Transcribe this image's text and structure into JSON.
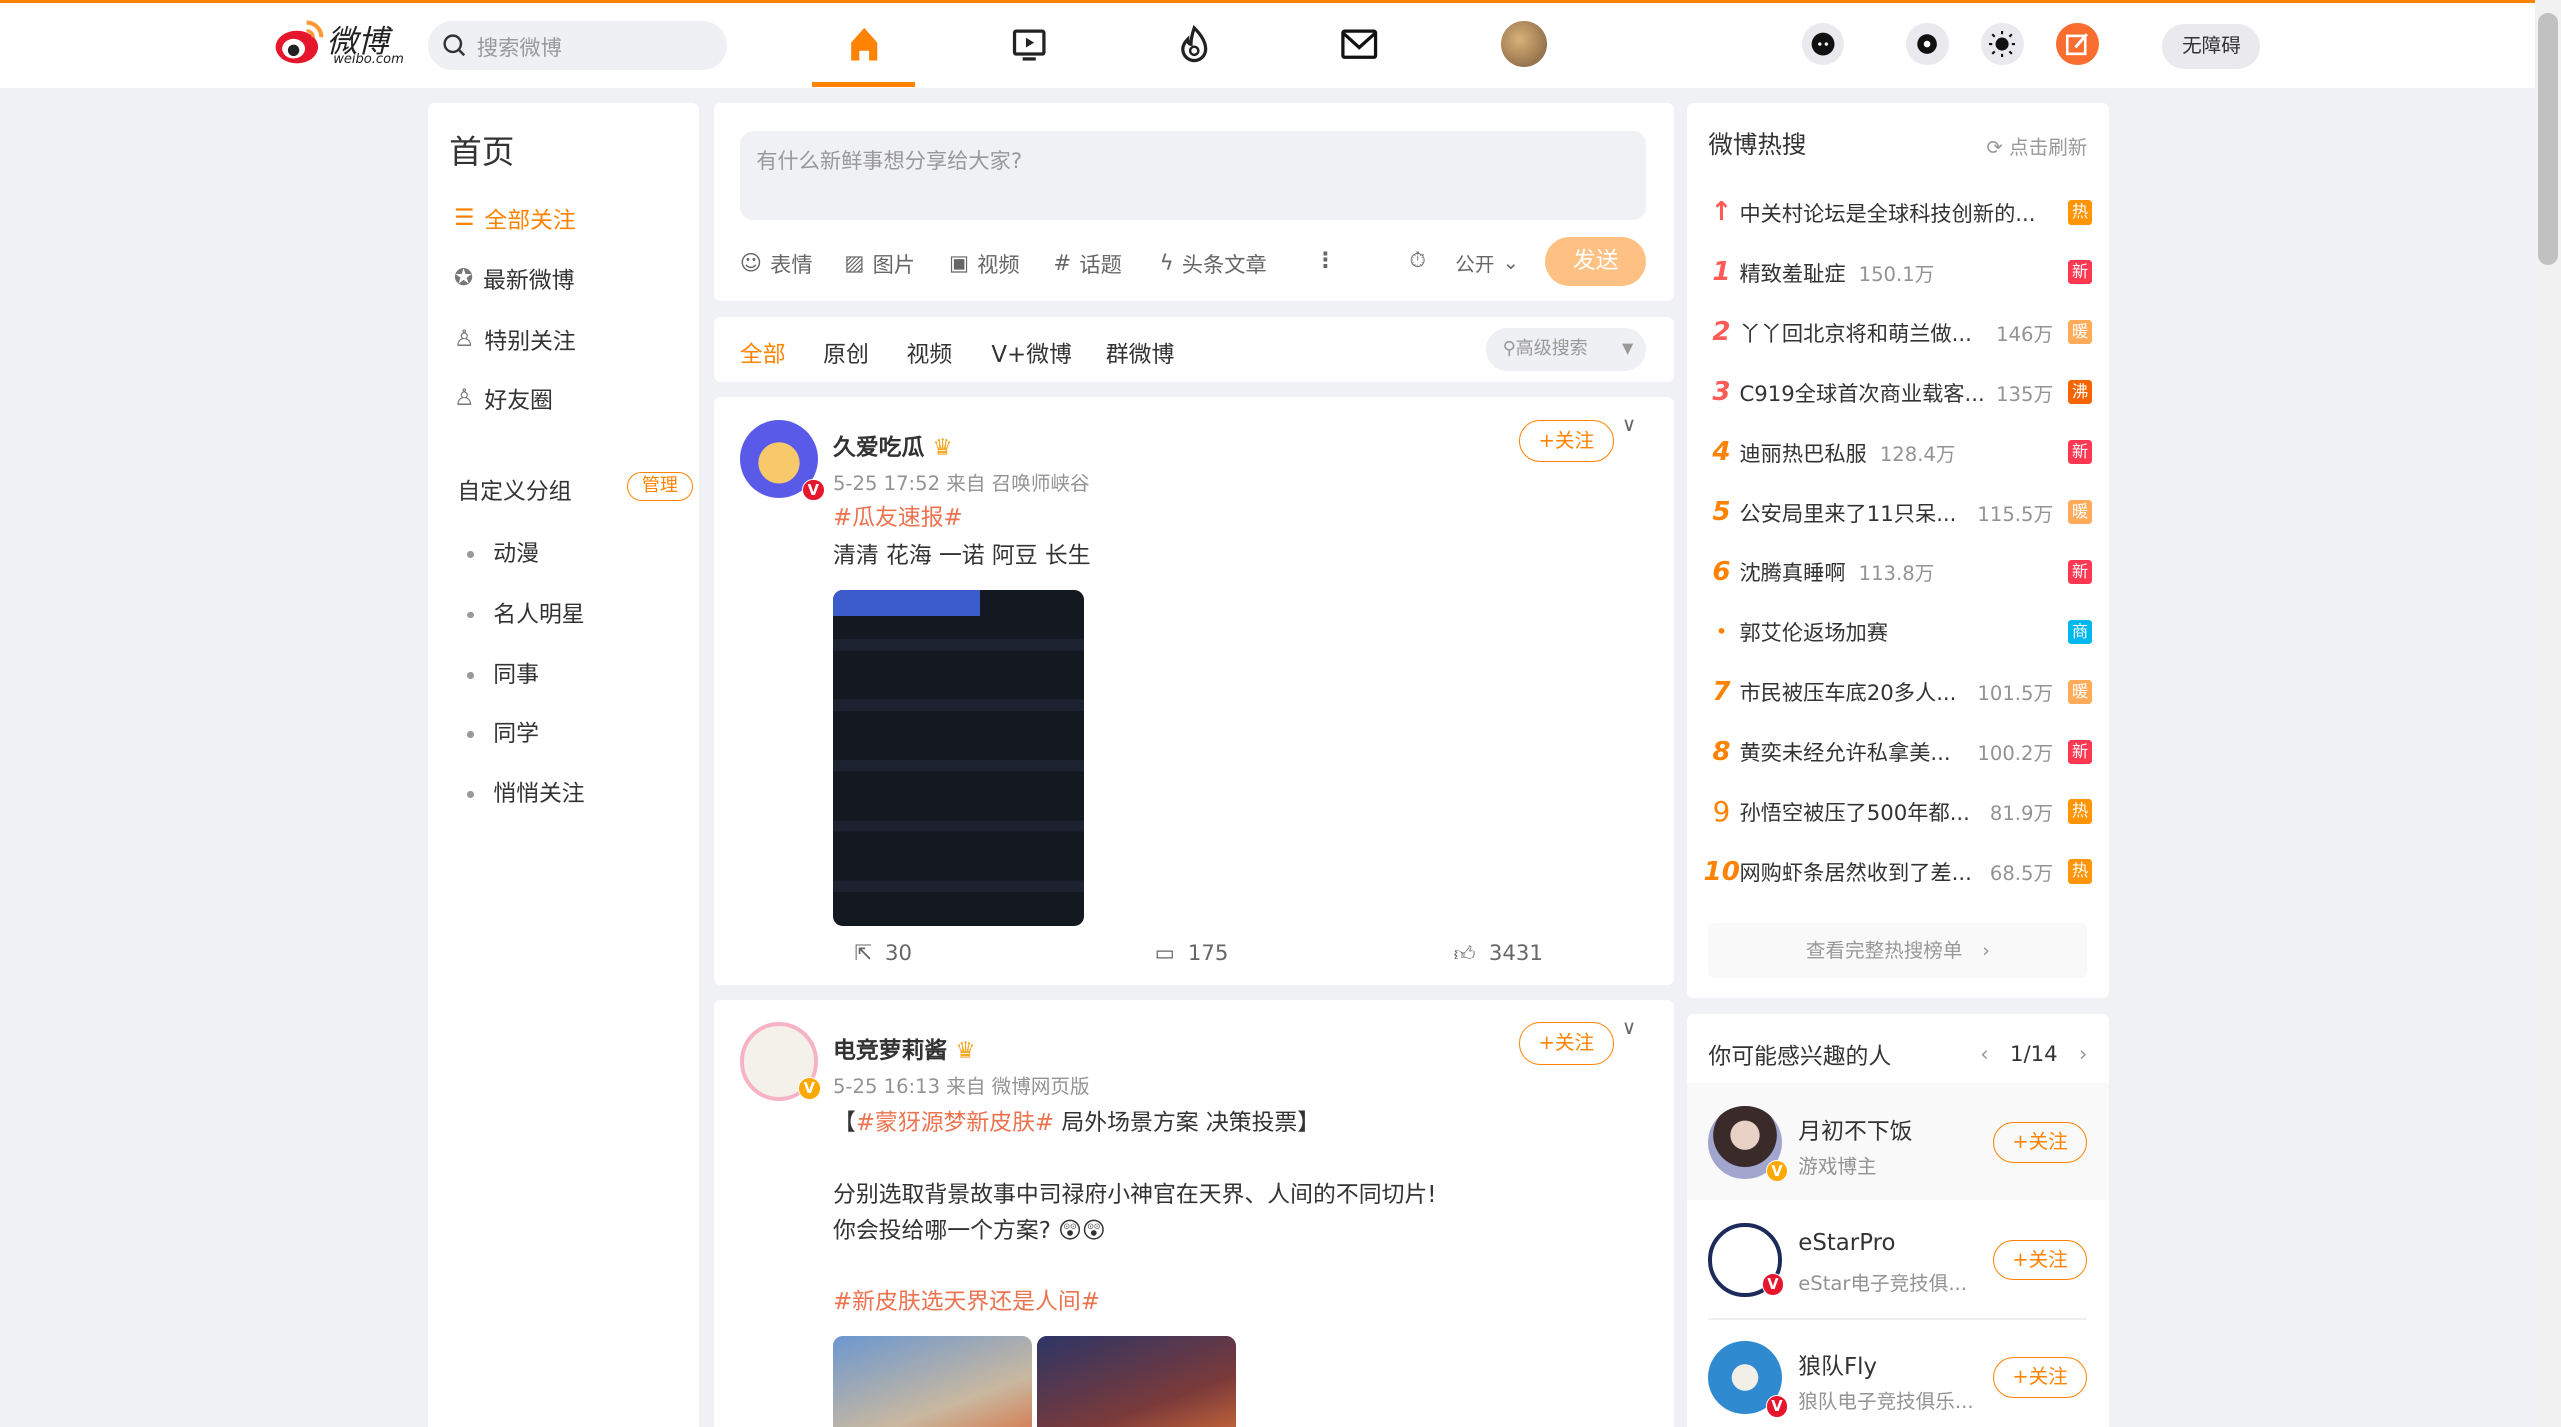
{
  "header": {
    "logo_text": "微博",
    "logo_sub": "weibo.com",
    "search_placeholder": "搜索微博",
    "accessibility": "无障碍",
    "nav": [
      "home-icon",
      "video-icon",
      "hot-icon",
      "message-icon",
      "avatar"
    ],
    "accent": "#ff8200"
  },
  "sidebar": {
    "title": "首页",
    "items": [
      {
        "label": "全部关注",
        "active": true
      },
      {
        "label": "最新微博"
      },
      {
        "label": "特别关注"
      },
      {
        "label": "好友圈"
      }
    ],
    "group_title": "自定义分组",
    "manage": "管理",
    "groups": [
      "动漫",
      "名人明星",
      "同事",
      "同学",
      "悄悄关注"
    ]
  },
  "compose": {
    "placeholder": "有什么新鲜事想分享给大家?",
    "tools": [
      "表情",
      "图片",
      "视频",
      "话题",
      "头条文章"
    ],
    "visibility": "公开",
    "send": "发送"
  },
  "feed_tabs": {
    "items": [
      "全部",
      "原创",
      "视频",
      "V+微博",
      "群微博"
    ],
    "search": "高级搜索"
  },
  "posts": [
    {
      "user": "久爱吃瓜",
      "time": "5-25 17:52",
      "source": "来自 召唤师峡谷",
      "follow": "+关注",
      "tag": "#瓜友速报#",
      "text": "清清 花海 一诺 阿豆 长生",
      "reposts": "30",
      "comments": "175",
      "likes": "3431"
    },
    {
      "user": "电竞萝莉酱",
      "time": "5-25 16:13",
      "source": "来自 微博网页版",
      "follow": "+关注",
      "l1_open": "【",
      "l1_tag": "#蒙犽源梦新皮肤#",
      "l1_rest": " 局外场景方案 决策投票】",
      "l2": "分别选取背景故事中司禄府小神官在天界、人间的不同切片!",
      "l3": "你会投给哪一个方案? 😲😲",
      "tag2": "#新皮肤选天界还是人间#"
    }
  ],
  "hot_search": {
    "title": "微博热搜",
    "refresh": "点击刷新",
    "full_list": "查看完整热搜榜单",
    "items": [
      {
        "rank": "↑",
        "title": "中关村论坛是全球科技创新的...",
        "count": "",
        "badge": "热",
        "badge_color": "#ff9406"
      },
      {
        "rank": "1",
        "title": "精致羞耻症",
        "count": "150.1万",
        "badge": "新",
        "badge_color": "#ff3852"
      },
      {
        "rank": "2",
        "title": "丫丫回北京将和萌兰做...",
        "count": "146万",
        "badge": "暖",
        "badge_color": "#ffab5a"
      },
      {
        "rank": "3",
        "title": "C919全球首次商业载客...",
        "count": "135万",
        "badge": "沸",
        "badge_color": "#f86400"
      },
      {
        "rank": "4",
        "title": "迪丽热巴私服",
        "count": "128.4万",
        "badge": "新",
        "badge_color": "#ff3852"
      },
      {
        "rank": "5",
        "title": "公安局里来了11只呆...",
        "count": "115.5万",
        "badge": "暖",
        "badge_color": "#ffab5a"
      },
      {
        "rank": "6",
        "title": "沈腾真睡啊",
        "count": "113.8万",
        "badge": "新",
        "badge_color": "#ff3852"
      },
      {
        "rank": "•",
        "title": "郭艾伦返场加赛",
        "count": "",
        "badge": "商",
        "badge_color": "#00b7ee"
      },
      {
        "rank": "7",
        "title": "市民被压车底20多人...",
        "count": "101.5万",
        "badge": "暖",
        "badge_color": "#ffab5a"
      },
      {
        "rank": "8",
        "title": "黄奕未经允许私拿美...",
        "count": "100.2万",
        "badge": "新",
        "badge_color": "#ff3852"
      },
      {
        "rank": "9",
        "title": "孙悟空被压了500年都...",
        "count": "81.9万",
        "badge": "热",
        "badge_color": "#ff9406"
      },
      {
        "rank": "10",
        "title": "网购虾条居然收到了差...",
        "count": "68.5万",
        "badge": "热",
        "badge_color": "#ff9406"
      }
    ]
  },
  "recommend": {
    "title": "你可能感兴趣的人",
    "page": "1/14",
    "follow": "+关注",
    "users": [
      {
        "name": "月初不下饭",
        "desc": "游戏博主"
      },
      {
        "name": "eStarPro",
        "desc": "eStar电子竞技俱..."
      },
      {
        "name": "狼队Fly",
        "desc": "狼队电子竞技俱乐..."
      }
    ]
  }
}
